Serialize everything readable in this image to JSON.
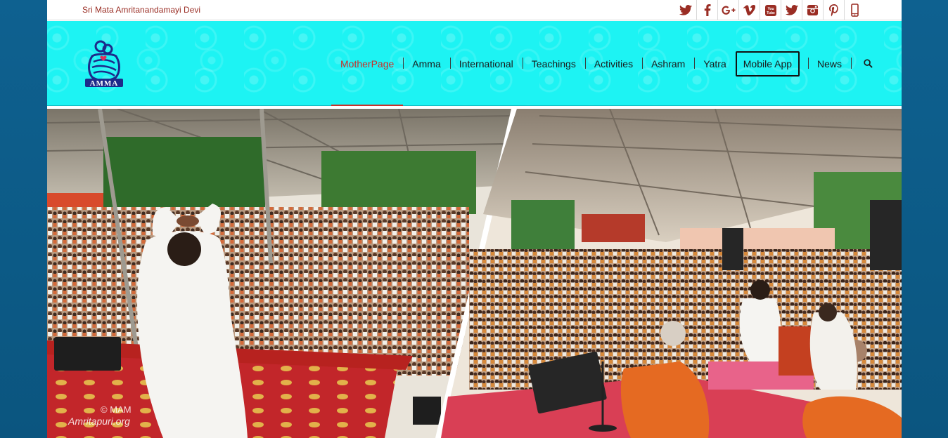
{
  "topbar": {
    "site_name": "Sri Mata Amritanandamayi Devi",
    "social_icons": [
      "twitter-icon",
      "facebook-icon",
      "google-plus-icon",
      "vimeo-icon",
      "youtube-icon",
      "twitter-icon",
      "instagram-icon",
      "pinterest-icon",
      "mobile-phone-icon"
    ]
  },
  "header": {
    "logo_text": "AMMA",
    "nav": [
      {
        "label": "MotherPage",
        "active": true
      },
      {
        "label": "Amma"
      },
      {
        "label": "International"
      },
      {
        "label": "Teachings"
      },
      {
        "label": "Activities"
      },
      {
        "label": "Ashram"
      },
      {
        "label": "Yatra"
      },
      {
        "label": "Mobile App",
        "boxed": true
      },
      {
        "label": "News"
      }
    ],
    "search_icon": "search-icon"
  },
  "hero": {
    "watermark_copyright": "© MAM",
    "watermark_site": "Amritapuri.org"
  },
  "colors": {
    "header_bg": "#1df3f3",
    "accent_red": "#c8302a",
    "topbar_text": "#9a2d24",
    "page_bg": "#0d5a86"
  }
}
